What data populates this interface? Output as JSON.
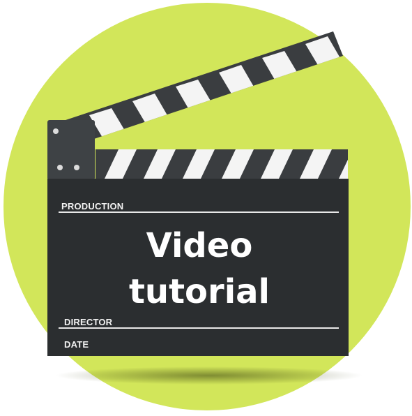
{
  "colors": {
    "circle": "#d2e65a",
    "board": "#2b2e30",
    "stripe_white": "#f4f4f4",
    "stripe_dark": "#3a3d40",
    "text": "#ffffff"
  },
  "slate": {
    "production_label": "PRODUCTION",
    "director_label": "DIRECTOR",
    "date_label": "DATE",
    "title_line1": "Video",
    "title_line2": "tutorial"
  },
  "icons": {
    "main": "clapperboard-icon"
  }
}
